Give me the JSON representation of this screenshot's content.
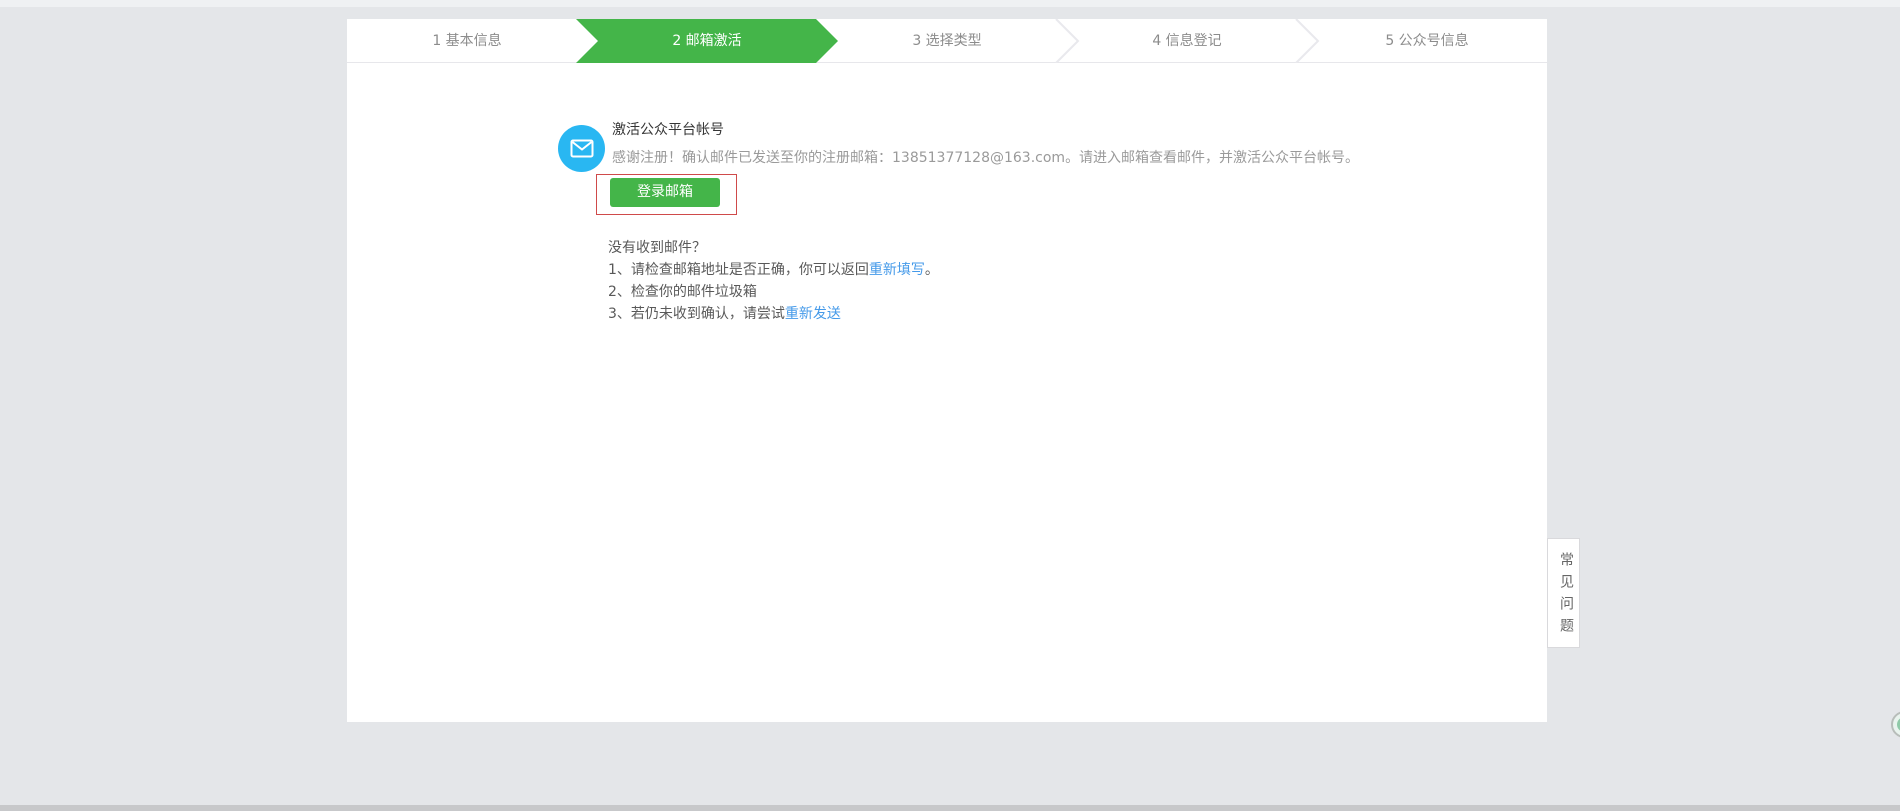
{
  "stepper": {
    "active_index": 1,
    "active_color": "#44b549",
    "steps": [
      {
        "label": "1 基本信息"
      },
      {
        "label": "2 邮箱激活"
      },
      {
        "label": "3 选择类型"
      },
      {
        "label": "4 信息登记"
      },
      {
        "label": "5 公众号信息"
      }
    ]
  },
  "activation": {
    "icon": "envelope-icon",
    "icon_color": "#29b7f2",
    "title": "激活公众平台帐号",
    "message_prefix": "感谢注册！确认邮件已发送至你的注册邮箱：",
    "email": "13851377128@163.com",
    "message_suffix": "。请进入邮箱查看邮件，并激活公众平台帐号。",
    "login_button": "登录邮箱",
    "button_color": "#44b549",
    "annotation_color": "#cf4a4a"
  },
  "help": {
    "heading": "没有收到邮件？",
    "item1_prefix": "1、请检查邮箱地址是否正确，你可以返回",
    "item1_link": "重新填写",
    "item1_suffix": "。",
    "item2": "2、检查你的邮件垃圾箱",
    "item3_prefix": "3、若仍未收到确认，请尝试",
    "item3_link": "重新发送",
    "link_color": "#459ae9"
  },
  "faq_tab": {
    "label": "常见问题"
  }
}
